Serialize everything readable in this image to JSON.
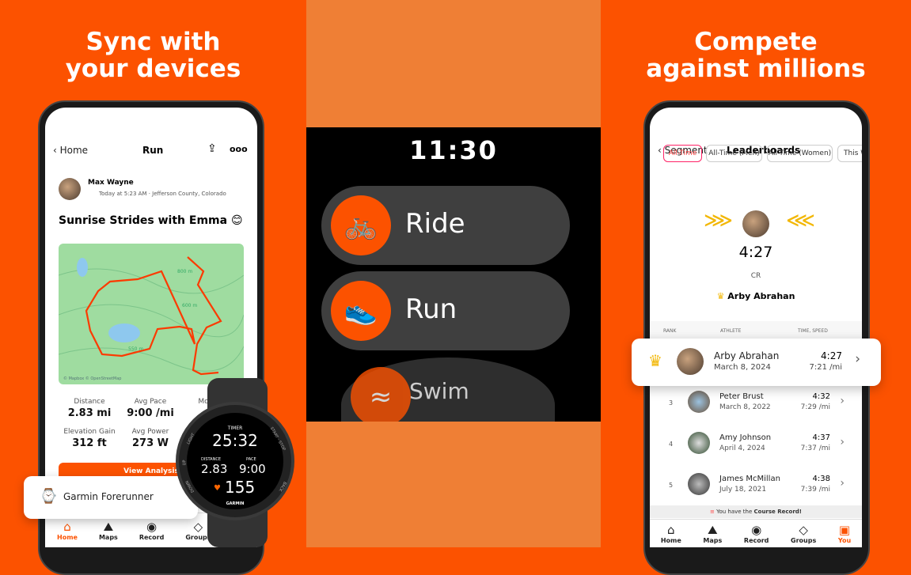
{
  "colors": {
    "brand": "#fc5200",
    "middle_bg": "#ef7f35",
    "crown": "#f2b705"
  },
  "left": {
    "headline": [
      "Sync with",
      "your devices"
    ],
    "header": {
      "back": "Home",
      "title": "Run",
      "share_icon": "share-icon",
      "more_icon": "more-icon"
    },
    "athlete": {
      "name": "Max Wayne",
      "meta": "Today at 5:23 AM · Jefferson County, Colorado"
    },
    "activity_title": "Sunrise Strides with Emma 😊",
    "map": {
      "labels": [
        "800 m",
        "600 m",
        "550 m"
      ],
      "attribution": "© Mapbox © OpenStreetMap"
    },
    "stats": [
      {
        "label": "Distance",
        "value": "2.83 mi"
      },
      {
        "label": "Avg Pace",
        "value": "9:00 /mi"
      },
      {
        "label": "Mo",
        "value": ""
      },
      {
        "label": "Elevation Gain",
        "value": "312 ft"
      },
      {
        "label": "Avg Power",
        "value": "273 W"
      }
    ],
    "view_analysis": "View Analysis",
    "device_toast": "Garmin Forerunner",
    "nav": [
      {
        "label": "Home",
        "icon": "⌂"
      },
      {
        "label": "Maps",
        "icon": "⛰"
      },
      {
        "label": "Record",
        "icon": "◉"
      },
      {
        "label": "Groups",
        "icon": "◇"
      }
    ],
    "garmin": {
      "timer_label": "TIMER",
      "timer": "25:32",
      "distance_label": "DISTANCE",
      "distance": "2.83",
      "pace_label": "PACE",
      "pace": "9:00",
      "heart_rate": "155",
      "brand": "GARMIN",
      "buttons": [
        "LIGHT",
        "UP",
        "DOWN",
        "START · STOP",
        "BACK"
      ]
    }
  },
  "middle": {
    "time": "11:30",
    "items": [
      {
        "label": "Ride",
        "icon": "🚲"
      },
      {
        "label": "Run",
        "icon": "👟"
      },
      {
        "label": "Swim",
        "icon": "≈"
      }
    ]
  },
  "right": {
    "headline": [
      "Compete",
      "against millions"
    ],
    "header": {
      "back": "Segment",
      "title": "Leaderboards"
    },
    "chips": [
      "All-Time",
      "All-Time (Men)",
      "All-Time (Women)",
      "This W"
    ],
    "cr": {
      "time": "4:27",
      "label": "CR",
      "holder": "Arby Abrahan"
    },
    "columns": [
      "RANK",
      "ATHLETE",
      "TIME, SPEED"
    ],
    "highlight": {
      "name": "Arby Abrahan",
      "date": "March 8, 2024",
      "time": "4:27",
      "speed": "7:21 /mi"
    },
    "rows": [
      {
        "rank": "3",
        "name": "Peter Brust",
        "date": "March 8, 2022",
        "time": "4:32",
        "speed": "7:29 /mi"
      },
      {
        "rank": "4",
        "name": "Amy Johnson",
        "date": "April 4, 2024",
        "time": "4:37",
        "speed": "7:37 /mi"
      },
      {
        "rank": "5",
        "name": "James McMillan",
        "date": "July 18, 2021",
        "time": "4:38",
        "speed": "7:39 /mi"
      }
    ],
    "banner_pre": "You have the ",
    "banner_bold": "Course Record!",
    "nav": [
      {
        "label": "Home",
        "icon": "⌂"
      },
      {
        "label": "Maps",
        "icon": "⛰"
      },
      {
        "label": "Record",
        "icon": "◉"
      },
      {
        "label": "Groups",
        "icon": "◇"
      },
      {
        "label": "You",
        "icon": "▣"
      }
    ]
  }
}
